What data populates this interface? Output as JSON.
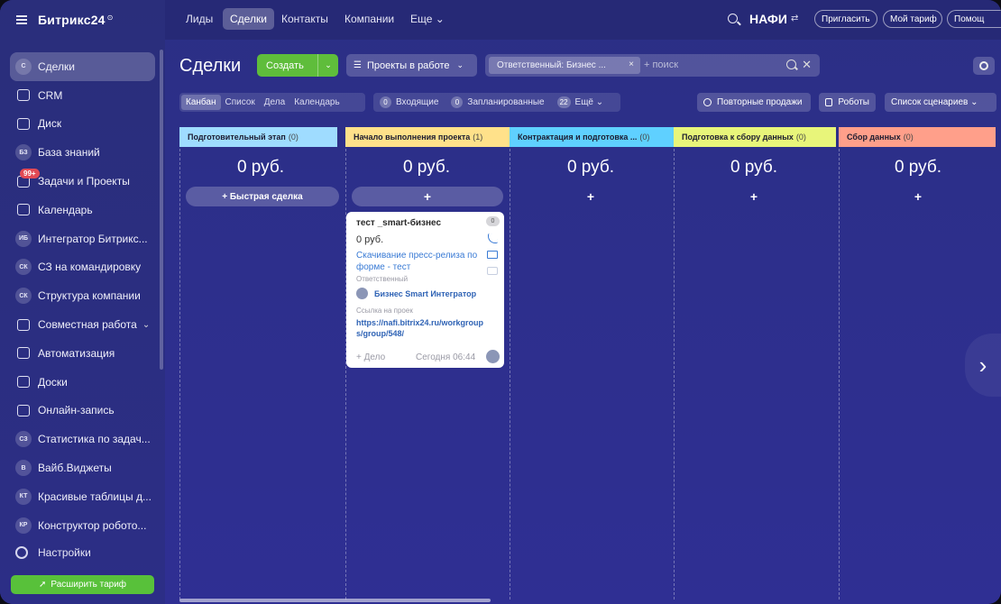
{
  "app": {
    "logo": "Битрикс24",
    "logo_clock": "⊙"
  },
  "sidebar": {
    "items": [
      {
        "label": "Сделки",
        "icon": "С",
        "icon_name": "circle-avatar-icon"
      },
      {
        "label": "CRM",
        "icon": "",
        "icon_name": "crm-icon"
      },
      {
        "label": "Диск",
        "icon": "",
        "icon_name": "disk-icon"
      },
      {
        "label": "База знаний",
        "icon": "БЗ",
        "icon_name": "circle-avatar-icon"
      },
      {
        "label": "Задачи и Проекты",
        "icon": "",
        "icon_name": "tasks-icon",
        "badge": "99+"
      },
      {
        "label": "Календарь",
        "icon": "",
        "icon_name": "calendar-icon"
      },
      {
        "label": "Интегратор Битрикс...",
        "icon": "ИБ",
        "icon_name": "circle-avatar-icon"
      },
      {
        "label": "СЗ на командировку",
        "icon": "СК",
        "icon_name": "circle-avatar-icon"
      },
      {
        "label": "Структура компании",
        "icon": "СК",
        "icon_name": "circle-avatar-icon"
      },
      {
        "label": "Совместная работа",
        "icon": "",
        "icon_name": "collab-icon",
        "chevron": "⌄"
      },
      {
        "label": "Автоматизация",
        "icon": "",
        "icon_name": "automation-icon"
      },
      {
        "label": "Доски",
        "icon": "",
        "icon_name": "boards-icon"
      },
      {
        "label": "Онлайн-запись",
        "icon": "",
        "icon_name": "booking-icon"
      },
      {
        "label": "Статистика по задач...",
        "icon": "СЗ",
        "icon_name": "circle-avatar-icon"
      },
      {
        "label": "Вайб.Виджеты",
        "icon": "В",
        "icon_name": "circle-avatar-icon"
      },
      {
        "label": "Красивые таблицы д...",
        "icon": "КТ",
        "icon_name": "circle-avatar-icon"
      },
      {
        "label": "Конструктор робото...",
        "icon": "КР",
        "icon_name": "circle-avatar-icon"
      }
    ],
    "settings": "Настройки",
    "upgrade": "Расширить тариф"
  },
  "topbar": {
    "tabs": [
      "Лиды",
      "Сделки",
      "Контакты",
      "Компании",
      "Еще ⌄"
    ],
    "company": "НАФИ",
    "company_icon": "⇄",
    "invite": "Пригласить",
    "tariff": "Мой тариф",
    "help": "Помощ"
  },
  "toolbar": {
    "title": "Сделки",
    "create": "Создать",
    "create_arrow": "⌄",
    "pipeline": "Проекты в работе",
    "filter_chip": "Ответственный: Бизнес ...",
    "filter_chip_close": "×",
    "search_placeholder": "+ поиск",
    "clear": "✕"
  },
  "views": {
    "tabs": [
      "Канбан",
      "Список",
      "Дела",
      "Календарь"
    ],
    "counters": [
      {
        "count": "0",
        "label": "Входящие"
      },
      {
        "count": "0",
        "label": "Запланированные"
      },
      {
        "count": "22",
        "label": "Ещё ⌄"
      }
    ],
    "repeat_sales": "Повторные продажи",
    "robots": "Роботы",
    "scenarios": "Список сценариев ⌄"
  },
  "kanban": {
    "columns": [
      {
        "title": "Подготовительный этап",
        "count": "(0)",
        "sum": "0 руб.",
        "color": "#9fdcff"
      },
      {
        "title": "Начало выполнения проекта",
        "count": "(1)",
        "sum": "0 руб.",
        "color": "#ffe18a"
      },
      {
        "title": "Контрактация и подготовка ...",
        "count": "(0)",
        "sum": "0 руб.",
        "color": "#5fd0ff"
      },
      {
        "title": "Подготовка к сбору данных",
        "count": "(0)",
        "sum": "0 руб.",
        "color": "#e8f57a"
      },
      {
        "title": "Сбор данных",
        "count": "(0)",
        "sum": "0 руб.",
        "color": "#ff9f8a"
      }
    ],
    "quick_deal": "+ Быстрая сделка",
    "plus": "+",
    "card": {
      "title": "тест _smart-бизнес",
      "badge": "0",
      "price": "0 руб.",
      "activity": "Скачивание пресс-релиза по форме - тест",
      "responsible_label": "Ответственный",
      "responsible": "Бизнес Smart Интегратор",
      "link_label": "Ссылка на проек",
      "link": "https://nafi.bitrix24.ru/workgroups/group/548/",
      "add_task": "+ Дело",
      "time": "Сегодня 06:44"
    },
    "next": "›"
  }
}
